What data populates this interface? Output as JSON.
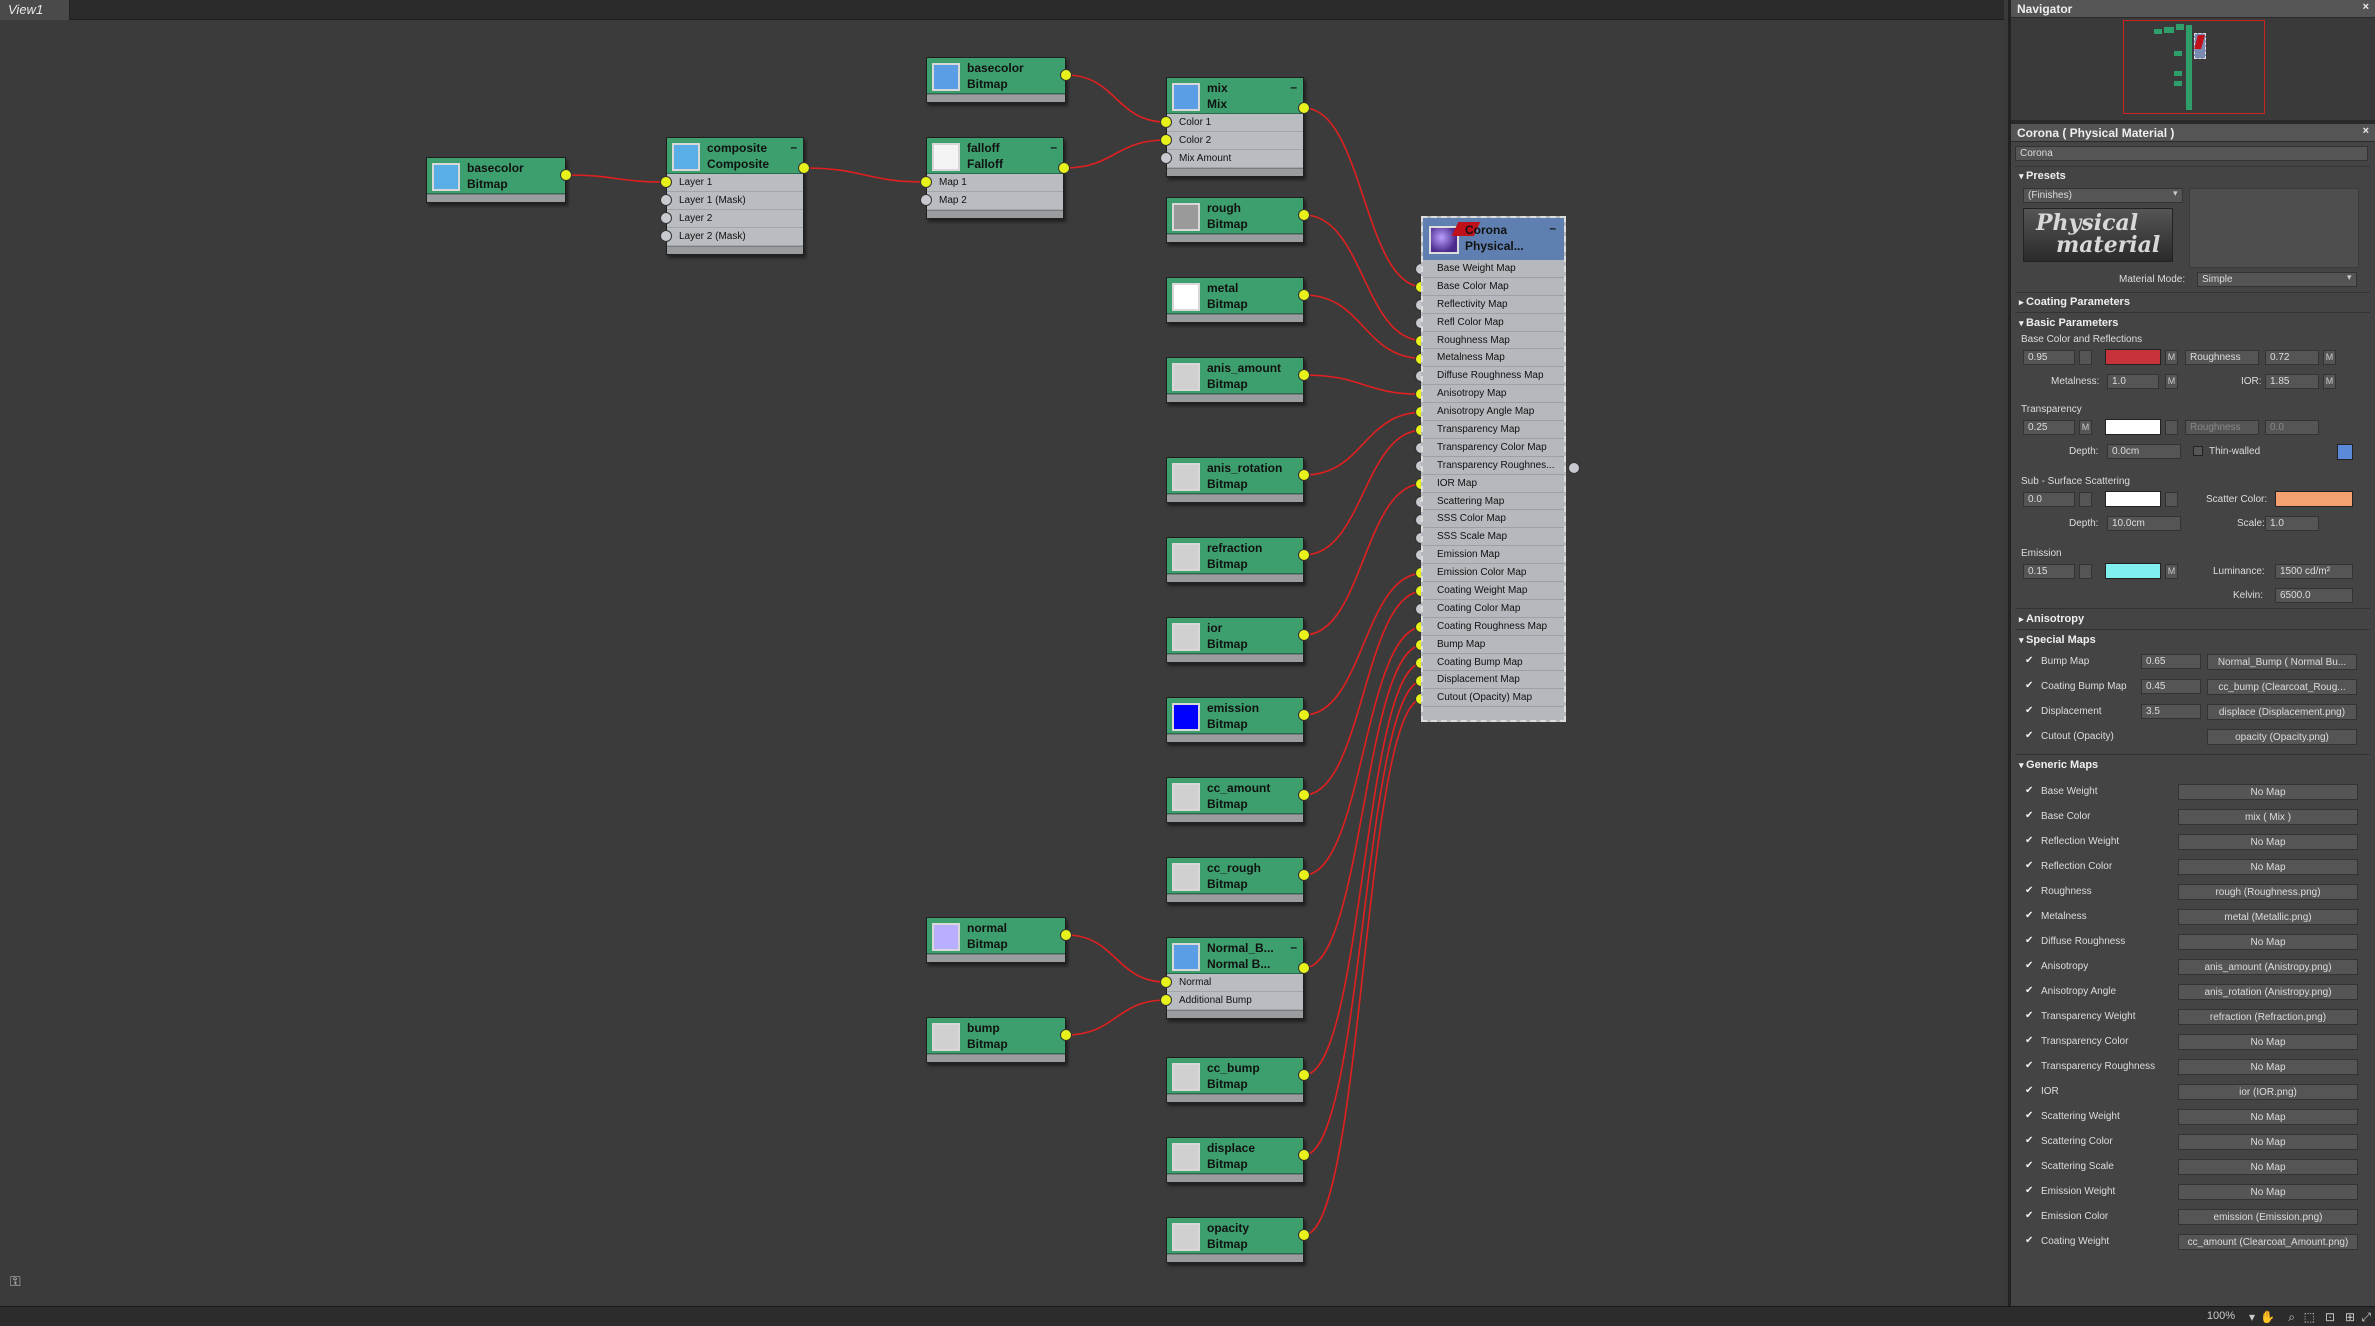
{
  "view": {
    "tab": "View1"
  },
  "nodes": [
    {
      "id": "bc1",
      "t1": "basecolor",
      "t2": "Bitmap",
      "swatch": "#5aaee6",
      "slots": []
    },
    {
      "id": "comp",
      "t1": "composite",
      "t2": "Composite",
      "swatch": "#5aaee6",
      "slots": [
        "Layer 1",
        "Layer 1 (Mask)",
        "Layer 2",
        "Layer 2 (Mask)"
      ]
    },
    {
      "id": "bc2",
      "t1": "basecolor",
      "t2": "Bitmap",
      "swatch": "#5a9ee6",
      "slots": []
    },
    {
      "id": "fall",
      "t1": "falloff",
      "t2": "Falloff",
      "swatch": "#f4f4f4",
      "slots": [
        "Map 1",
        "Map 2"
      ]
    },
    {
      "id": "mix",
      "t1": "mix",
      "t2": "Mix",
      "swatch": "#5a9ee6",
      "slots": [
        "Color 1",
        "Color 2",
        "Mix Amount"
      ]
    },
    {
      "id": "rough",
      "t1": "rough",
      "t2": "Bitmap",
      "swatch": "#9a9a9a",
      "slots": []
    },
    {
      "id": "metal",
      "t1": "metal",
      "t2": "Bitmap",
      "swatch": "#ffffff",
      "slots": []
    },
    {
      "id": "anisA",
      "t1": "anis_amount",
      "t2": "Bitmap",
      "swatch": "#d0d0d0",
      "slots": []
    },
    {
      "id": "anisR",
      "t1": "anis_rotation",
      "t2": "Bitmap",
      "swatch": "#d0d0d0",
      "slots": []
    },
    {
      "id": "refr",
      "t1": "refraction",
      "t2": "Bitmap",
      "swatch": "#d0d0d0",
      "slots": []
    },
    {
      "id": "ior",
      "t1": "ior",
      "t2": "Bitmap",
      "swatch": "#d0d0d0",
      "slots": []
    },
    {
      "id": "emis",
      "t1": "emission",
      "t2": "Bitmap",
      "swatch": "#0000ff",
      "slots": []
    },
    {
      "id": "cca",
      "t1": "cc_amount",
      "t2": "Bitmap",
      "swatch": "#d0d0d0",
      "slots": []
    },
    {
      "id": "ccr",
      "t1": "cc_rough",
      "t2": "Bitmap",
      "swatch": "#d0d0d0",
      "slots": []
    },
    {
      "id": "norm",
      "t1": "normal",
      "t2": "Bitmap",
      "swatch": "#b8b0ff",
      "slots": []
    },
    {
      "id": "nb",
      "t1": "Normal_B...",
      "t2": "Normal B...",
      "swatch": "#5a9ee6",
      "slots": [
        "Normal",
        "Additional Bump"
      ]
    },
    {
      "id": "bump",
      "t1": "bump",
      "t2": "Bitmap",
      "swatch": "#d0d0d0",
      "slots": []
    },
    {
      "id": "ccb",
      "t1": "cc_bump",
      "t2": "Bitmap",
      "swatch": "#d0d0d0",
      "slots": []
    },
    {
      "id": "disp",
      "t1": "displace",
      "t2": "Bitmap",
      "swatch": "#d0d0d0",
      "slots": []
    },
    {
      "id": "opac",
      "t1": "opacity",
      "t2": "Bitmap",
      "swatch": "#d0d0d0",
      "slots": []
    }
  ],
  "corona_node": {
    "t1": "Corona",
    "t2": "Physical...",
    "slots": [
      "Base Weight Map",
      "Base Color Map",
      "Reflectivity Map",
      "Refl Color Map",
      "Roughness Map",
      "Metalness Map",
      "Diffuse Roughness Map",
      "Anisotropy Map",
      "Anisotropy Angle Map",
      "Transparency Map",
      "Transparency Color Map",
      "Transparency Roughnes...",
      "IOR Map",
      "Scattering Map",
      "SSS Color Map",
      "SSS Scale Map",
      "Emission Map",
      "Emission Color Map",
      "Coating Weight Map",
      "Coating Color Map",
      "Coating Roughness Map",
      "Bump Map",
      "Coating Bump Map",
      "Displacement Map",
      "Cutout (Opacity) Map"
    ]
  },
  "navigator": {
    "title": "Navigator"
  },
  "material": {
    "title": "Corona  ( Physical Material )",
    "name": "Corona",
    "presets": {
      "label": "Presets",
      "dropdown": "(Finishes)",
      "logo1": "Physical",
      "logo2": "material",
      "mode_label": "Material Mode:",
      "mode_value": "Simple"
    },
    "coating": "Coating Parameters",
    "basic": "Basic Parameters",
    "base_group": "Base Color and Reflections",
    "base_level": "0.95",
    "base_color": "#c8323a",
    "rough_mode": "Roughness",
    "rough_val": "0.72",
    "metal_label": "Metalness:",
    "metal_val": "1.0",
    "ior_label": "IOR:",
    "ior_val": "1.85",
    "trans_group": "Transparency",
    "trans_level": "0.25",
    "trans_color": "#ffffff",
    "trans_rough": "Roughness",
    "trans_rough_val": "0.0",
    "depth_label": "Depth:",
    "trans_depth": "0.0cm",
    "thin": "Thin-walled",
    "sss_group": "Sub - Surface Scattering",
    "sss_level": "0.0",
    "sss_color": "#ffffff",
    "scatter_label": "Scatter Color:",
    "scatter_color": "#f4a070",
    "sss_depth": "10.0cm",
    "scale_label": "Scale:",
    "sss_scale": "1.0",
    "emis_group": "Emission",
    "emis_level": "0.15",
    "emis_color": "#80f0f0",
    "lum_label": "Luminance:",
    "lum_val": "1500 cd/m²",
    "kelvin_label": "Kelvin:",
    "kelvin_val": "6500.0",
    "aniso": "Anisotropy",
    "special": "Special Maps",
    "special_rows": [
      {
        "label": "Bump Map",
        "val": "0.65",
        "map": "Normal_Bump  ( Normal Bu..."
      },
      {
        "label": "Coating Bump Map",
        "val": "0.45",
        "map": "cc_bump (Clearcoat_Roug..."
      },
      {
        "label": "Displacement",
        "val": "3.5",
        "map": "displace (Displacement.png)"
      },
      {
        "label": "Cutout (Opacity)",
        "val": "",
        "map": "opacity (Opacity.png)"
      }
    ],
    "generic": "Generic Maps",
    "generic_rows": [
      {
        "label": "Base Weight",
        "map": "No Map"
      },
      {
        "label": "Base Color",
        "map": "mix  ( Mix )"
      },
      {
        "label": "Reflection Weight",
        "map": "No Map"
      },
      {
        "label": "Reflection Color",
        "map": "No Map"
      },
      {
        "label": "Roughness",
        "map": "rough (Roughness.png)"
      },
      {
        "label": "Metalness",
        "map": "metal (Metallic.png)"
      },
      {
        "label": "Diffuse Roughness",
        "map": "No Map"
      },
      {
        "label": "Anisotropy",
        "map": "anis_amount (Anistropy.png)"
      },
      {
        "label": "Anisotropy Angle",
        "map": "anis_rotation (Anistropy.png)"
      },
      {
        "label": "Transparency Weight",
        "map": "refraction (Refraction.png)"
      },
      {
        "label": "Transparency Color",
        "map": "No Map"
      },
      {
        "label": "Transparency Roughness",
        "map": "No Map"
      },
      {
        "label": "IOR",
        "map": "ior (IOR.png)"
      },
      {
        "label": "Scattering Weight",
        "map": "No Map"
      },
      {
        "label": "Scattering Color",
        "map": "No Map"
      },
      {
        "label": "Scattering Scale",
        "map": "No Map"
      },
      {
        "label": "Emission Weight",
        "map": "No Map"
      },
      {
        "label": "Emission Color",
        "map": "emission (Emission.png)"
      },
      {
        "label": "Coating Weight",
        "map": "cc_amount (Clearcoat_Amount.png)"
      }
    ],
    "m": "M"
  },
  "status": {
    "zoom": "100%"
  }
}
